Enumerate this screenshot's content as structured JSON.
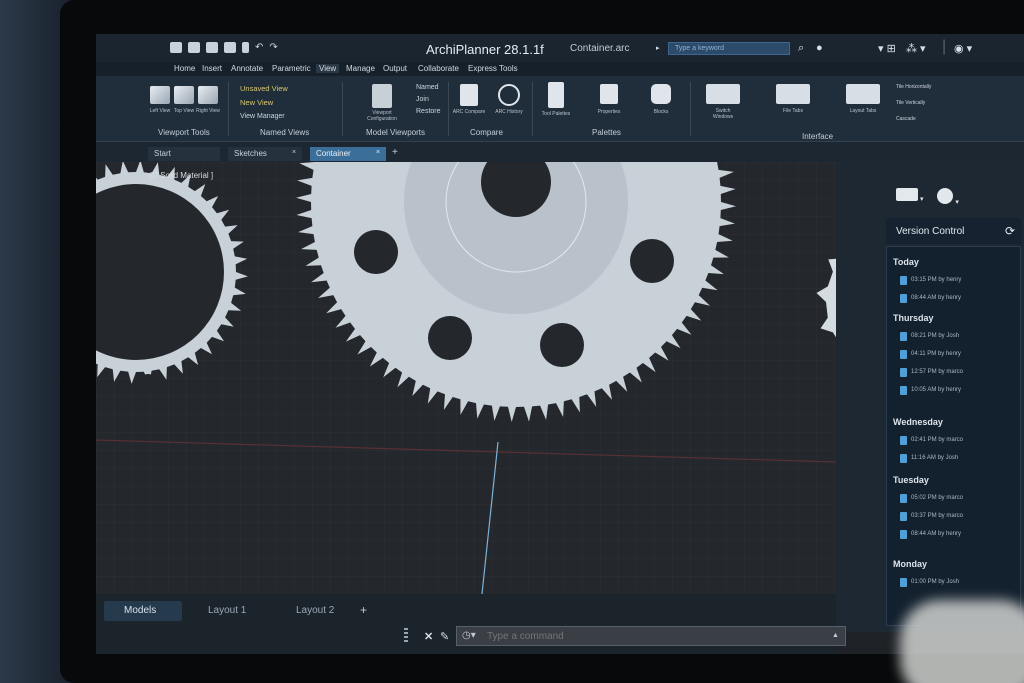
{
  "app": {
    "title": "ArchiPlanner 28.1.1f",
    "file_name": "Container.arc",
    "search_placeholder": "Type a keyword"
  },
  "menu": [
    "Home",
    "Insert",
    "Annotate",
    "Parametric",
    "View",
    "Manage",
    "Output",
    "Collaborate",
    "Express Tools"
  ],
  "menu_active": "View",
  "ribbon": {
    "viewport_tools": {
      "label": "Viewport Tools",
      "buttons": [
        "Left View",
        "Top View",
        "Right View"
      ]
    },
    "named_views": {
      "label": "Named Views",
      "items": [
        "Unsaved View",
        "New View",
        "View Manager"
      ]
    },
    "model_viewports": {
      "label": "Model Viewports",
      "button": "Viewport Configuration",
      "items": [
        "Named",
        "Join",
        "Restore"
      ]
    },
    "compare": {
      "label": "Compare",
      "buttons": [
        "ARC Compare",
        "ARC History"
      ]
    },
    "palettes": {
      "label": "Palettes",
      "buttons": [
        "Tool Palettes",
        "Properties",
        "Blocks"
      ]
    },
    "interface": {
      "label": "Interface",
      "buttons": [
        "Switch Windows",
        "File Tabs",
        "Layout Tabs"
      ],
      "small": [
        "Tile Horizontally",
        "Tile Vertically",
        "Cascade"
      ]
    }
  },
  "doc_tabs": [
    "Start",
    "Sketches",
    "Container"
  ],
  "doc_tab_active": "Container",
  "canvas": {
    "view_label": "[D Solid Material ]"
  },
  "version_control": {
    "title": "Version Control",
    "groups": [
      {
        "day": "Today",
        "entries": [
          "03:15 PM by henry",
          "08:44 AM by henry"
        ]
      },
      {
        "day": "Thursday",
        "entries": [
          "08:21 PM by Josh",
          "04:11 PM by henry",
          "12:57 PM by marco",
          "10:05 AM by henry"
        ]
      },
      {
        "day": "Wednesday",
        "entries": [
          "02:41 PM by marco",
          "11:16 AM by Josh"
        ]
      },
      {
        "day": "Tuesday",
        "entries": [
          "05:02 PM by marco",
          "03:37 PM by marco",
          "08:44 AM by henry"
        ]
      },
      {
        "day": "Monday",
        "entries": [
          "01:00 PM by Josh"
        ]
      }
    ]
  },
  "layout_tabs": [
    "Models",
    "Layout 1",
    "Layout 2"
  ],
  "layout_tab_active": "Models",
  "command": {
    "placeholder": "Type a command"
  },
  "colors": {
    "accent": "#3b6f99",
    "gear": "#c8d0d8",
    "grid": "#2b3035",
    "red_axis": "#5a2f34"
  }
}
